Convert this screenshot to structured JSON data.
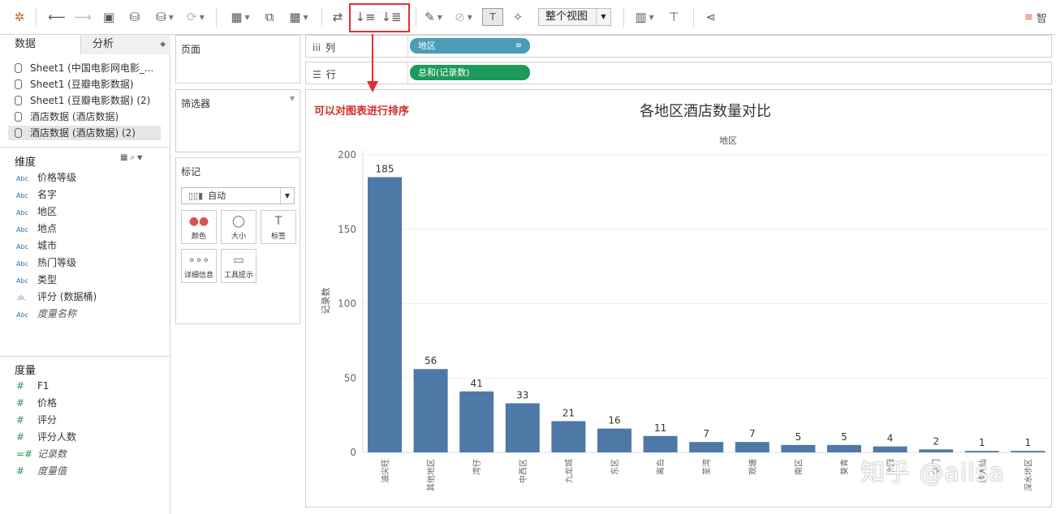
{
  "toolbar": {
    "fit_mode": "整个视图",
    "right_label": "智"
  },
  "annotation": "可以对图表进行排序",
  "sidebar": {
    "tab_data": "数据",
    "tab_analysis": "分析",
    "datasources": [
      "Sheet1 (中国电影网电影_...",
      "Sheet1 (豆瓣电影数据)",
      "Sheet1 (豆瓣电影数据) (2)",
      "酒店数据 (酒店数据)",
      "酒店数据 (酒店数据) (2)"
    ],
    "dimensions_title": "维度",
    "dimensions": [
      {
        "icon": "Abc",
        "name": "价格等级"
      },
      {
        "icon": "Abc",
        "name": "名字"
      },
      {
        "icon": "Abc",
        "name": "地区"
      },
      {
        "icon": "Abc",
        "name": "地点"
      },
      {
        "icon": "Abc",
        "name": "城市"
      },
      {
        "icon": "Abc",
        "name": "热门等级"
      },
      {
        "icon": "Abc",
        "name": "类型"
      },
      {
        "icon": ".ılı.",
        "name": "评分 (数据桶)"
      },
      {
        "icon": "Abc",
        "name": "度量名称"
      }
    ],
    "measures_title": "度量",
    "measures": [
      {
        "icon": "#",
        "name": "F1"
      },
      {
        "icon": "#",
        "name": "价格"
      },
      {
        "icon": "#",
        "name": "评分"
      },
      {
        "icon": "#",
        "name": "评分人数"
      },
      {
        "icon": "=#",
        "name": "记录数"
      },
      {
        "icon": "#",
        "name": "度量值"
      }
    ]
  },
  "cards": {
    "pages": "页面",
    "filters": "筛选器",
    "marks": "标记",
    "mark_type": "自动",
    "mark_buttons": [
      {
        "icon": "●●",
        "label": "颜色"
      },
      {
        "icon": "◯",
        "label": "大小"
      },
      {
        "icon": "T",
        "label": "标签"
      },
      {
        "icon": "∘∘∘",
        "label": "详细信息"
      },
      {
        "icon": "▭",
        "label": "工具提示"
      }
    ]
  },
  "shelves": {
    "columns_label": "列",
    "rows_label": "行",
    "columns_pill": "地区",
    "rows_pill": "总和(记录数)"
  },
  "chart_data": {
    "type": "bar",
    "title": "各地区酒店数量对比",
    "xlabel": "地区",
    "ylabel": "记录数",
    "ylim": [
      0,
      200
    ],
    "yticks": [
      0,
      50,
      100,
      150,
      200
    ],
    "categories": [
      "油尖旺",
      "其他地区",
      "湾仔",
      "中西区",
      "九龙城",
      "东区",
      "离岛",
      "荃湾",
      "观塘",
      "南区",
      "葵青",
      "沙田",
      "屯门",
      "黄大仙",
      "深水埗区"
    ],
    "values": [
      185,
      56,
      41,
      33,
      21,
      16,
      11,
      7,
      7,
      5,
      5,
      4,
      2,
      1,
      1
    ],
    "color": "#4e79a7",
    "grid": true
  },
  "watermark": "知乎 @ailsa"
}
